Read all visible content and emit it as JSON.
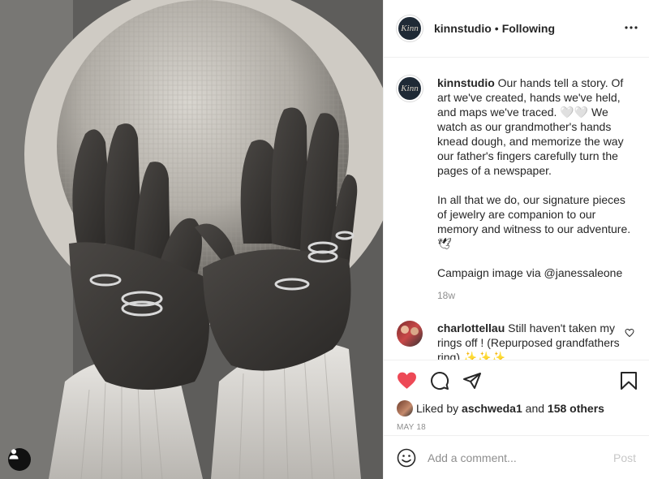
{
  "post": {
    "image_alt": "Black and white photo of a woman's hands covering her face under a straw hat, wearing rings"
  },
  "header": {
    "avatar_text": "Kinn",
    "username": "kinnstudio",
    "separator": "•",
    "follow_status": "Following",
    "more_icon": "more-horizontal-icon"
  },
  "caption": {
    "username": "kinnstudio",
    "paragraphs": [
      "Our hands tell a story. Of art we've created, hands we've held, and maps we've traced. 🤍🤍 We watch as our grandmother's hands knead dough, and memorize the way our father's fingers carefully turn the pages of a newspaper.",
      "In all that we do, our signature pieces of jewelry are companion to our memory and witness to our adventure. 🕊",
      "Campaign image via @janessaleone"
    ],
    "timestamp": "18w"
  },
  "comments": [
    {
      "username": "charlottellau",
      "text": "Still haven't taken my rings off ! (Repurposed grandfathers ring) ✨✨✨"
    }
  ],
  "actions": {
    "like_icon": "heart-filled-icon",
    "comment_icon": "comment-icon",
    "share_icon": "share-icon",
    "save_icon": "bookmark-icon",
    "liked_color": "#ed4956"
  },
  "likes": {
    "prefix": "Liked by",
    "liked_by_user": "aschweda1",
    "and": "and",
    "others": "158 others"
  },
  "date": "MAY 18",
  "add_comment": {
    "placeholder": "Add a comment...",
    "post_label": "Post"
  }
}
